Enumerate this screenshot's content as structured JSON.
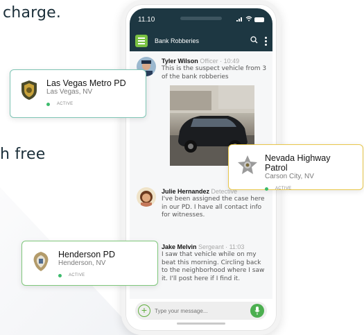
{
  "background": {
    "line1": "charge.",
    "line2": "h free"
  },
  "phone": {
    "status": {
      "time": "11.10"
    },
    "app_bar": {
      "title": "Bank Robberies"
    },
    "messages": [
      {
        "name": "Tyler Wilson",
        "meta": "Officer · 10:49",
        "text": "This is the suspect vehicle from 3 of the bank robberies"
      },
      {
        "name": "Julie Hernandez",
        "meta": "Detective",
        "text": "I've been assigned the case here in our PD. I have all contact info for witnesses."
      },
      {
        "name": "Jake Melvin",
        "meta": "Sergeant · 11:03",
        "text": "I saw that vehicle while on my beat this morning. Circling back to the neighborhood where I saw it. I'll post here if I find it."
      }
    ],
    "composer": {
      "placeholder": "Type your message..."
    }
  },
  "cards": {
    "las_vegas": {
      "name": "Las Vegas Metro PD",
      "location": "Las Vegas, NV",
      "status": "ACTIVE"
    },
    "nevada_hp": {
      "name": "Nevada Highway Patrol",
      "location": "Carson City, NV",
      "status": "ACTIVE"
    },
    "henderson": {
      "name": "Henderson PD",
      "location": "Henderson, NV",
      "status": "ACTIVE"
    }
  },
  "colors": {
    "app_bar": "#1d3742",
    "accent_green": "#7ac143",
    "status_active": "#3dbb6d"
  }
}
